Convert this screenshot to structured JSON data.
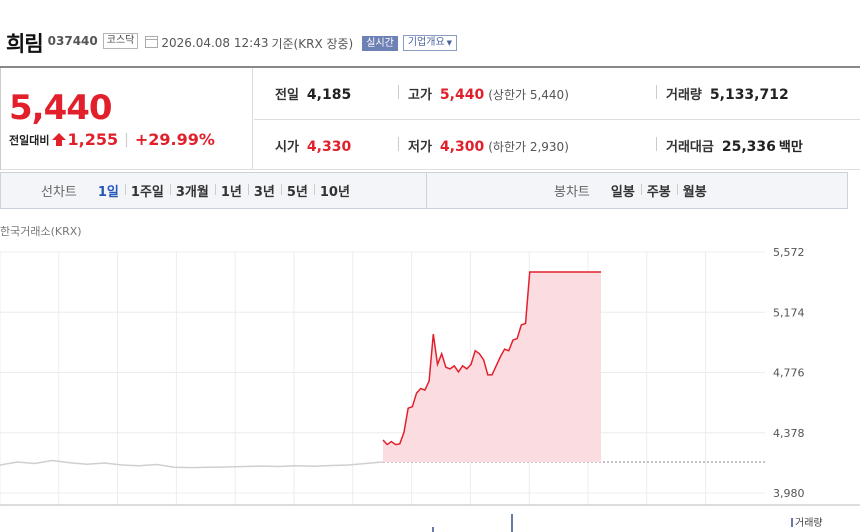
{
  "header": {
    "name": "희림",
    "code": "037440",
    "market": "코스닥",
    "datetime": "2026.04.08 12:43",
    "basis": "기준(KRX 장중)",
    "live_badge": "실시간",
    "company_badge": "기업개요"
  },
  "price": {
    "current": "5,440",
    "change_label": "전일대비",
    "change": "1,255",
    "change_pct": "+29.99%",
    "direction": "up"
  },
  "stats": {
    "prev_close": {
      "label": "전일",
      "value": "4,185"
    },
    "high": {
      "label": "고가",
      "value": "5,440",
      "note": "(상한가 5,440)"
    },
    "volume": {
      "label": "거래량",
      "value": "5,133,712"
    },
    "open": {
      "label": "시가",
      "value": "4,330"
    },
    "low": {
      "label": "저가",
      "value": "4,300",
      "note": "(하한가 2,930)"
    },
    "trade_value": {
      "label": "거래대금",
      "value": "25,336",
      "unit": "백만"
    }
  },
  "tabs": {
    "line_label": "선차트",
    "line_tabs": [
      "1일",
      "1주일",
      "3개월",
      "1년",
      "3년",
      "5년",
      "10년"
    ],
    "active_line_tab": 0,
    "candle_label": "봉차트",
    "candle_tabs": [
      "일봉",
      "주봉",
      "월봉"
    ]
  },
  "chart": {
    "source": "한국거래소(KRX)",
    "volume_label": "거래량"
  },
  "colors": {
    "up": "#e2202c",
    "active_tab": "#2456b8",
    "prev_line": "#cfcfcf",
    "area_fill": "#fbdde1"
  },
  "chart_data": {
    "type": "area",
    "y_ticks": [
      "5,572",
      "5,174",
      "4,776",
      "4,378",
      "3,980"
    ],
    "ylim": [
      3980,
      5572
    ],
    "reference_line": {
      "label": "전일",
      "value": 4185
    },
    "previous_day_series": {
      "x": [
        0,
        3,
        6,
        9,
        12,
        15,
        18,
        21,
        24,
        27,
        30,
        33,
        36,
        39,
        42,
        45,
        48,
        51,
        54,
        57,
        60,
        63,
        66
      ],
      "values": [
        4165,
        4185,
        4175,
        4195,
        4180,
        4170,
        4178,
        4165,
        4160,
        4168,
        4150,
        4148,
        4150,
        4152,
        4155,
        4158,
        4155,
        4160,
        4157,
        4162,
        4165,
        4175,
        4185
      ]
    },
    "today_series": {
      "x": [
        0,
        1,
        2,
        3,
        4,
        5,
        6,
        7,
        8,
        9,
        10,
        11,
        12,
        13,
        14,
        15,
        16,
        17,
        18,
        19,
        20,
        21,
        22,
        23,
        24,
        25,
        26,
        27,
        28,
        29,
        30,
        31,
        32,
        33,
        34,
        35,
        36,
        37,
        38,
        39,
        40,
        41,
        42,
        43,
        44,
        45,
        46,
        47,
        48,
        49,
        50,
        51,
        52
      ],
      "values": [
        4330,
        4300,
        4320,
        4300,
        4305,
        4380,
        4540,
        4550,
        4640,
        4670,
        4660,
        4720,
        5030,
        4830,
        4900,
        4810,
        4800,
        4820,
        4780,
        4820,
        4800,
        4830,
        4920,
        4900,
        4860,
        4760,
        4760,
        4820,
        4880,
        4930,
        4920,
        4990,
        5000,
        5090,
        5100,
        5440,
        5440,
        5440,
        5440,
        5440,
        5440,
        5440,
        5440,
        5440,
        5440,
        5440,
        5440,
        5440,
        5440,
        5440,
        5440,
        5440,
        5440
      ]
    }
  }
}
